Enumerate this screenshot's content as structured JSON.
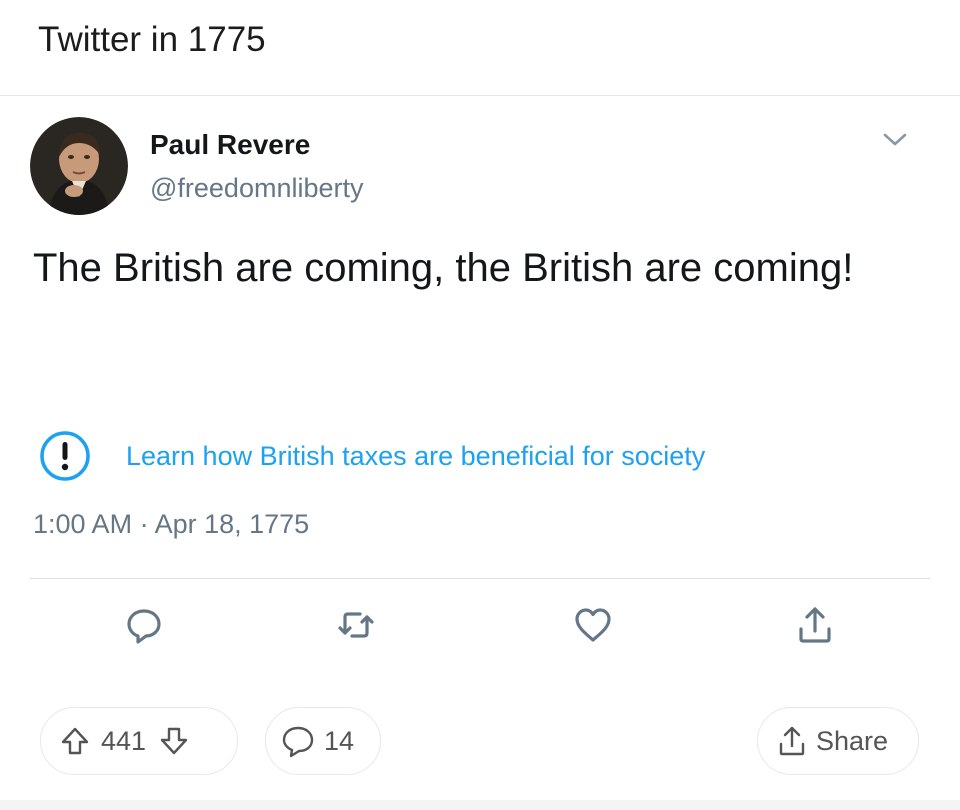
{
  "post": {
    "title": "Twitter in 1775"
  },
  "tweet": {
    "avatar": "portrait-avatar",
    "display_name": "Paul Revere",
    "handle": "@freedomnliberty",
    "menu_icon": "chevron-down-icon",
    "text": "The British are coming, the British are coming!",
    "notice": {
      "icon": "exclamation-circle-icon",
      "link_text": "Learn how British taxes are beneficial for society",
      "color": "#1da1f2"
    },
    "timestamp": "1:00 AM · Apr 18, 1775",
    "actions": [
      {
        "name": "reply",
        "icon": "reply-icon"
      },
      {
        "name": "retweet",
        "icon": "retweet-icon"
      },
      {
        "name": "like",
        "icon": "heart-icon"
      },
      {
        "name": "share",
        "icon": "upload-icon"
      }
    ]
  },
  "reddit_bar": {
    "votes": "441",
    "comments": "14",
    "share_label": "Share"
  }
}
